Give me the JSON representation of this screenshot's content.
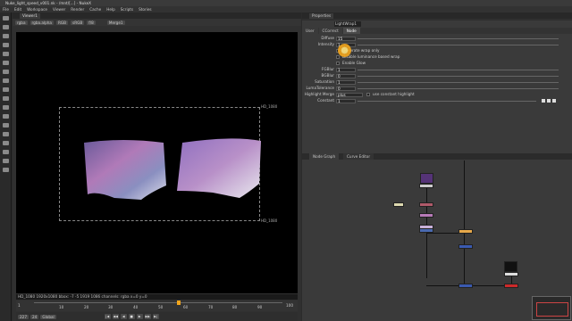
{
  "window": {
    "title": "Nuke_light_speed_v001.nk - /mnt/[...] - NukeX"
  },
  "menu": [
    "File",
    "Edit",
    "Workspace",
    "Viewer",
    "Render",
    "Cache",
    "Help",
    "Scripts",
    "Stories"
  ],
  "viewer": {
    "tab": "Viewer1",
    "channels": "rgba",
    "alpha": "rgba.alpha",
    "colorspace": "RGB",
    "lut": "sRGB",
    "gain": "f/8",
    "merge": "Merge1",
    "format_tl": "HD_1080",
    "format_br": "HD_1080",
    "info": "HD_1080 1920x1080  bbox: -7 -5 1919 1086 channels: rgba  x=0 y=0",
    "frame": "227",
    "fps": "24",
    "mode": "Global",
    "range_start": "1",
    "range_end": "100",
    "ticks": [
      "10",
      "20",
      "30",
      "40",
      "50",
      "60",
      "70",
      "80",
      "90"
    ]
  },
  "properties": {
    "tab": "Properties",
    "node_name": "LightWrap1",
    "tabs": [
      "User",
      "CCorrect",
      "Node"
    ],
    "rows": [
      {
        "label": "Diffuse",
        "value": "15"
      },
      {
        "label": "Intensity",
        "value": "1"
      },
      {
        "label": "",
        "check": "Generate wrap only"
      },
      {
        "label": "",
        "check": "Disable luminance based wrap"
      },
      {
        "label": "",
        "check": "Enable Glow"
      },
      {
        "label": "FGBlur",
        "value": "1"
      },
      {
        "label": "BGBlur",
        "value": "0"
      },
      {
        "label": "Saturation",
        "value": "1"
      },
      {
        "label": "LumaTolerance",
        "value": "0"
      },
      {
        "label": "Highlight Merge",
        "value": "plus",
        "check": "use constant highlight"
      },
      {
        "label": "Constant",
        "value": "1"
      }
    ]
  },
  "nodegraph": {
    "tabs": [
      "Node Graph",
      "Curve Editor"
    ]
  },
  "colors": {
    "accent": "#f3a61c",
    "canvas": "#000000",
    "panel": "#3a3a3a"
  }
}
